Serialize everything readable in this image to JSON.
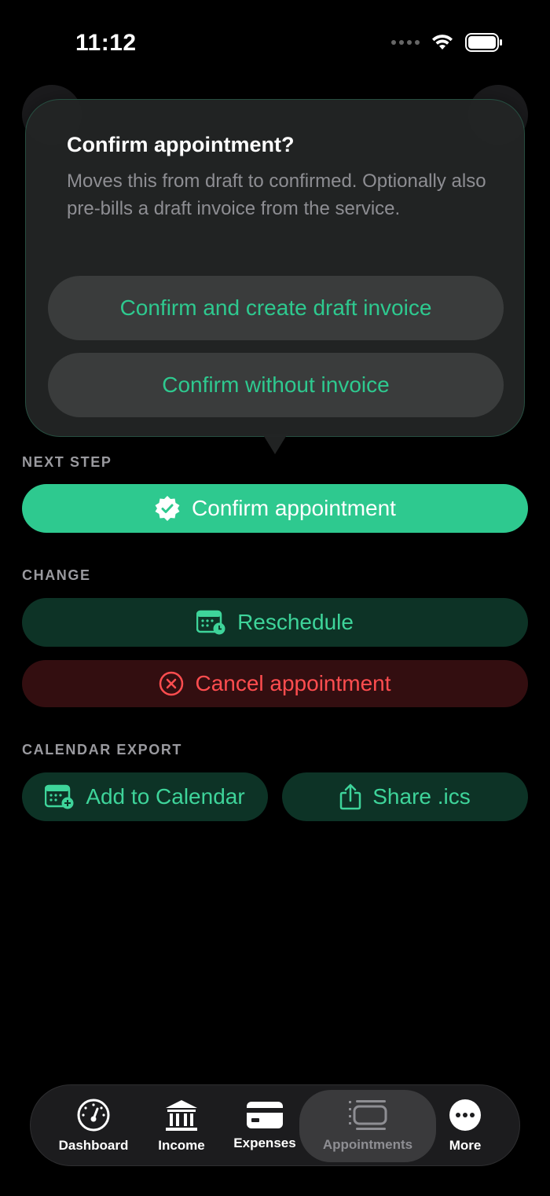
{
  "status_bar": {
    "time": "11:12"
  },
  "popover": {
    "title": "Confirm appointment?",
    "message": "Moves this from draft to confirmed. Optionally also pre-bills a draft invoice from the service.",
    "option_1": "Confirm and create draft invoice",
    "option_2": "Confirm without invoice"
  },
  "next_step": {
    "label": "NEXT STEP",
    "confirm_button": "Confirm appointment"
  },
  "change": {
    "label": "CHANGE",
    "reschedule_button": "Reschedule",
    "cancel_button": "Cancel appointment"
  },
  "calendar_export": {
    "label": "CALENDAR EXPORT",
    "add_button": "Add to Calendar",
    "share_button": "Share .ics"
  },
  "tabbar": {
    "items": [
      {
        "label": "Dashboard",
        "icon": "gauge-icon"
      },
      {
        "label": "Income",
        "icon": "bank-icon"
      },
      {
        "label": "Expenses",
        "icon": "credit-card-icon"
      },
      {
        "label": "Appointments",
        "icon": "appointments-icon"
      },
      {
        "label": "More",
        "icon": "more-icon"
      }
    ],
    "active": "Appointments"
  },
  "colors": {
    "accent": "#2ec98f",
    "accent_text": "#3ed49a",
    "danger": "#ff4d4f",
    "background": "#000000"
  }
}
